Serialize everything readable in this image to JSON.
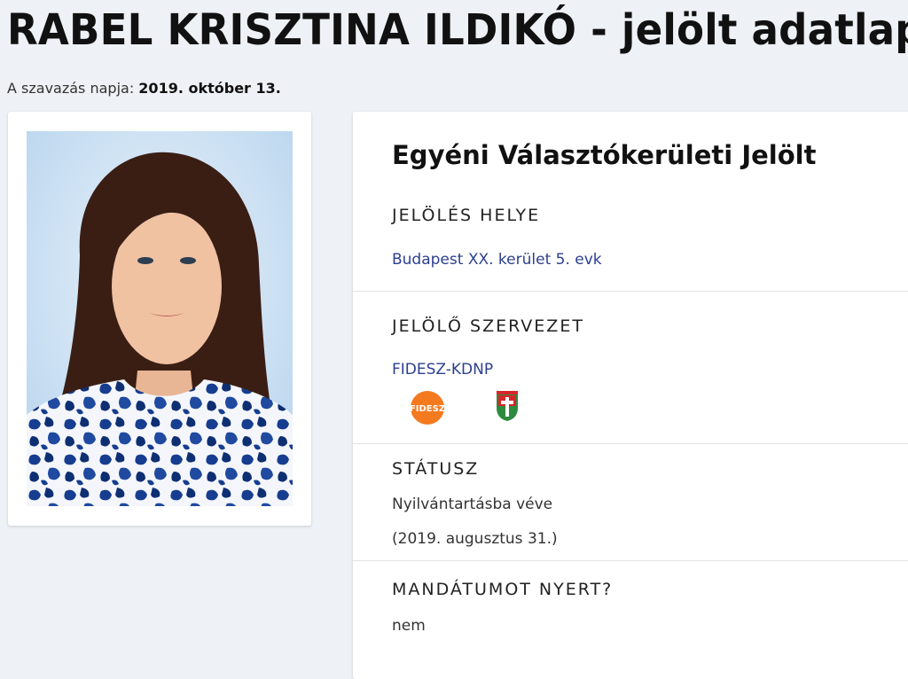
{
  "header": {
    "title": "RABEL KRISZTINA ILDIKÓ - jelölt adatlap",
    "vote_date_label": "A szavazás napja: ",
    "vote_date_value": "2019. október 13."
  },
  "candidate": {
    "photo_icon": "candidate-portrait",
    "type_heading": "Egyéni Választókerületi Jelölt",
    "sections": {
      "place": {
        "label": "JELÖLÉS HELYE",
        "value": "Budapest XX. kerület 5. evk"
      },
      "organization": {
        "label": "JELÖLŐ SZERVEZET",
        "value": "FIDESZ-KDNP",
        "logos": [
          {
            "name": "fidesz-logo",
            "text": "FIDESZ",
            "color": "#f47a20"
          },
          {
            "name": "kdnp-logo",
            "text": "KDNP",
            "color": "#2e8b3d"
          }
        ]
      },
      "status": {
        "label": "STÁTUSZ",
        "value": "Nyilvántartásba véve",
        "date": "(2019. augusztus 31.)"
      },
      "mandate": {
        "label": "MANDÁTUMOT NYERT?",
        "value": "nem"
      }
    }
  },
  "colors": {
    "link": "#2c3f8f",
    "background": "#eef1f5"
  }
}
